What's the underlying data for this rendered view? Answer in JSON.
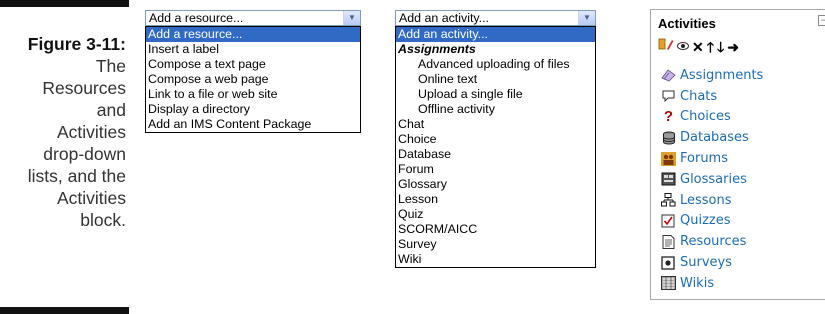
{
  "caption": {
    "figure_label": "Figure 3-11:",
    "lines": [
      "The",
      "Resources",
      "and",
      "Activities",
      "drop-down",
      "lists, and the",
      "Activities",
      "block."
    ]
  },
  "resource_dropdown": {
    "selected_value": "Add a resource...",
    "options": [
      "Add a resource...",
      "Insert a label",
      "Compose a text page",
      "Compose a web page",
      "Link to a file or web site",
      "Display a directory",
      "Add an IMS Content Package"
    ]
  },
  "activity_dropdown": {
    "selected_value": "Add an activity...",
    "options": [
      {
        "label": "Add an activity...",
        "kind": "selected"
      },
      {
        "label": "Assignments",
        "kind": "group"
      },
      {
        "label": "Advanced uploading of files",
        "kind": "indent"
      },
      {
        "label": "Online text",
        "kind": "indent"
      },
      {
        "label": "Upload a single file",
        "kind": "indent"
      },
      {
        "label": "Offline activity",
        "kind": "indent"
      },
      {
        "label": "Chat",
        "kind": "normal"
      },
      {
        "label": "Choice",
        "kind": "normal"
      },
      {
        "label": "Database",
        "kind": "normal"
      },
      {
        "label": "Forum",
        "kind": "normal"
      },
      {
        "label": "Glossary",
        "kind": "normal"
      },
      {
        "label": "Lesson",
        "kind": "normal"
      },
      {
        "label": "Quiz",
        "kind": "normal"
      },
      {
        "label": "SCORM/AICC",
        "kind": "normal"
      },
      {
        "label": "Survey",
        "kind": "normal"
      },
      {
        "label": "Wiki",
        "kind": "normal"
      }
    ]
  },
  "activities_block": {
    "title": "Activities",
    "tools": [
      "edit-icon",
      "eye-icon",
      "delete-icon",
      "move-up-icon",
      "move-down-icon",
      "move-right-icon"
    ],
    "items": [
      {
        "label": "Assignments",
        "icon": "assignment-icon"
      },
      {
        "label": "Chats",
        "icon": "chat-icon"
      },
      {
        "label": "Choices",
        "icon": "choice-icon"
      },
      {
        "label": "Databases",
        "icon": "database-icon"
      },
      {
        "label": "Forums",
        "icon": "forum-icon"
      },
      {
        "label": "Glossaries",
        "icon": "glossary-icon"
      },
      {
        "label": "Lessons",
        "icon": "lesson-icon"
      },
      {
        "label": "Quizzes",
        "icon": "quiz-icon"
      },
      {
        "label": "Resources",
        "icon": "resource-icon"
      },
      {
        "label": "Surveys",
        "icon": "survey-icon"
      },
      {
        "label": "Wikis",
        "icon": "wiki-icon"
      }
    ]
  },
  "colors": {
    "selection": "#316ac5",
    "link": "#1e6cb4",
    "select_border": "#7f9db9"
  }
}
